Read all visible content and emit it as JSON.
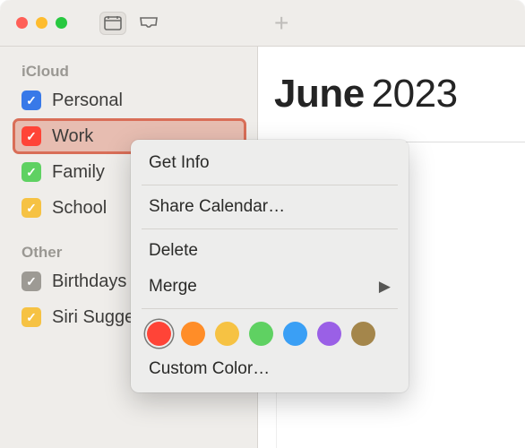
{
  "titlebar": {
    "add_label": "+"
  },
  "sidebar": {
    "group1_title": "iCloud",
    "calendars1": [
      {
        "label": "Personal",
        "color": "#3879e8",
        "selected": false
      },
      {
        "label": "Work",
        "color": "#ff4437",
        "selected": true
      },
      {
        "label": "Family",
        "color": "#5fd162",
        "selected": false
      },
      {
        "label": "School",
        "color": "#f6c243",
        "selected": false
      }
    ],
    "group2_title": "Other",
    "calendars2": [
      {
        "label": "Birthdays",
        "color": "#9d9a94",
        "selected": false
      },
      {
        "label": "Siri Suggestions",
        "color": "#f6c243",
        "selected": false
      }
    ]
  },
  "main": {
    "month": "June",
    "year": "2023"
  },
  "context_menu": {
    "get_info": "Get Info",
    "share": "Share Calendar…",
    "delete": "Delete",
    "merge": "Merge",
    "custom_color": "Custom Color…",
    "swatches": [
      {
        "color": "#ff4437",
        "selected": true
      },
      {
        "color": "#ff8d28",
        "selected": false
      },
      {
        "color": "#f6c243",
        "selected": false
      },
      {
        "color": "#5fd162",
        "selected": false
      },
      {
        "color": "#3a9ff5",
        "selected": false
      },
      {
        "color": "#9a60e6",
        "selected": false
      },
      {
        "color": "#a4864b",
        "selected": false
      }
    ]
  }
}
